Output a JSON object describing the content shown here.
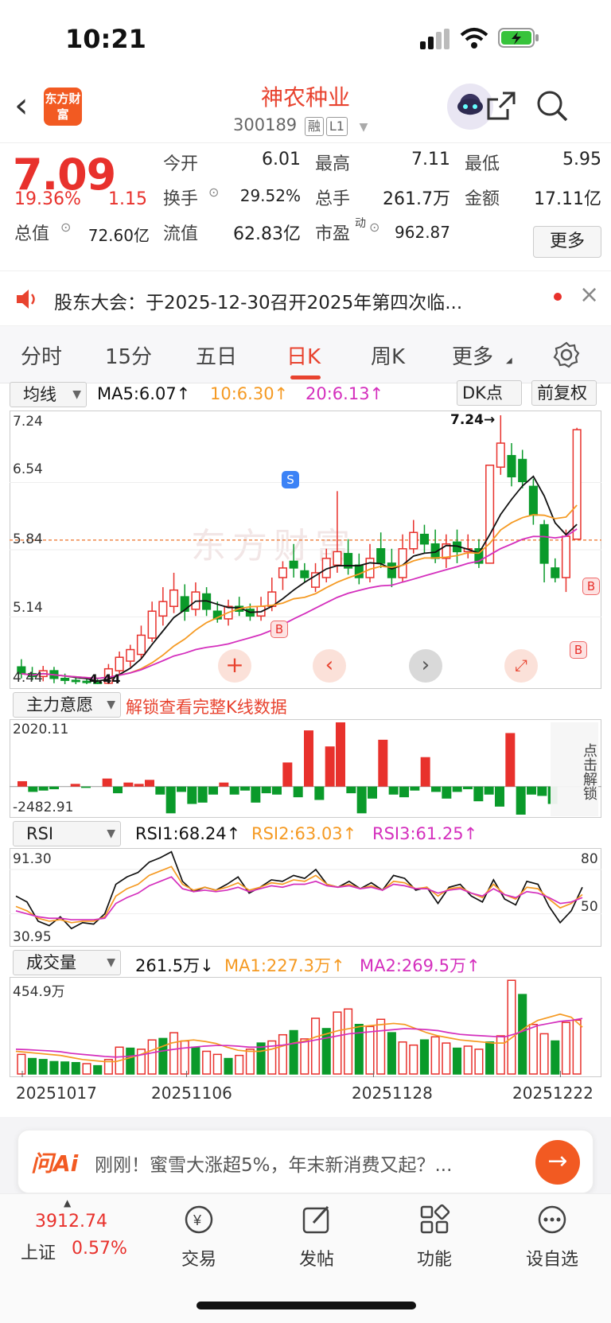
{
  "status_bar": {
    "time": "10:21"
  },
  "header": {
    "logo_text": "东方财富",
    "stock_name": "神农种业",
    "stock_code": "300189",
    "tag1": "融",
    "tag2": "L1"
  },
  "quote": {
    "price": "7.09",
    "change_pct": "19.36%",
    "change_amt": "1.15",
    "open_label": "今开",
    "open_value": "6.01",
    "high_label": "最高",
    "high_value": "7.11",
    "low_label": "最低",
    "low_value": "5.95",
    "turnover_label": "换手",
    "turnover_value": "29.52%",
    "volume_label": "总手",
    "volume_value": "261.7万",
    "amount_label": "金额",
    "amount_value": "17.11亿",
    "mktcap_label": "总值",
    "mktcap_value": "72.60亿",
    "float_label": "流值",
    "float_value": "62.83亿",
    "pe_label": "市盈",
    "pe_sup": "动",
    "pe_value": "962.87",
    "more_button": "更多"
  },
  "notice": {
    "text": "股东大会：于2025-12-30召开2025年第四次临..."
  },
  "tabs": [
    {
      "label": "分时"
    },
    {
      "label": "15分"
    },
    {
      "label": "五日"
    },
    {
      "label": "日K"
    },
    {
      "label": "周K"
    },
    {
      "label": "更多"
    }
  ],
  "kline": {
    "indicator_select": "均线",
    "ma5": "MA5:6.07↑",
    "ma10": "10:6.30↑",
    "ma20": "20:6.13↑",
    "dk_button": "DK点",
    "adjust_button": "前复权",
    "y_labels": [
      "7.24",
      "6.54",
      "5.84",
      "5.14",
      "4.44"
    ],
    "max_label": "7.24→",
    "min_label": "4.44",
    "marker_s": "S",
    "marker_b": "B",
    "watermark": "东方财富"
  },
  "main_force": {
    "select": "主力意愿",
    "unlock_text": "解锁查看完整K线数据",
    "ymax": "2020.11",
    "ymin": "-2482.91",
    "side_button": "点击解锁"
  },
  "rsi": {
    "select": "RSI",
    "rsi1": "RSI1:68.24↑",
    "rsi2": "RSI2:63.03↑",
    "rsi3": "RSI3:61.25↑",
    "ymax": "91.30",
    "ymin": "30.95",
    "r80": "80",
    "r50": "50"
  },
  "volume": {
    "select": "成交量",
    "current": "261.5万↓",
    "ma1": "MA1:227.3万↑",
    "ma2": "MA2:269.5万↑",
    "ymax": "454.9万",
    "dates": [
      "20251017",
      "20251106",
      "20251128",
      "20251222"
    ]
  },
  "ai_bar": {
    "logo": "问Ai",
    "text": "刚刚！蜜雪大涨超5%，年末新消费又起？..."
  },
  "bottom_nav": {
    "index_value": "3912.74",
    "index_name": "上证",
    "index_change": "0.57%",
    "items": [
      {
        "label": "交易"
      },
      {
        "label": "发帖"
      },
      {
        "label": "功能"
      },
      {
        "label": "设自选"
      }
    ]
  },
  "colors": {
    "up": "#e8312c",
    "down": "#0a9a2a",
    "ma5": "#111111",
    "ma10": "#f59a23",
    "ma20": "#d42fbd",
    "accent": "#e8432f"
  },
  "chart_data": {
    "type": "candlestick",
    "ylim": [
      4.44,
      7.24
    ],
    "candles": [
      {
        "o": 4.62,
        "c": 4.55,
        "h": 4.7,
        "l": 4.5
      },
      {
        "o": 4.55,
        "c": 4.52,
        "h": 4.62,
        "l": 4.48
      },
      {
        "o": 4.52,
        "c": 4.58,
        "h": 4.63,
        "l": 4.47
      },
      {
        "o": 4.58,
        "c": 4.5,
        "h": 4.62,
        "l": 4.45
      },
      {
        "o": 4.5,
        "c": 4.48,
        "h": 4.55,
        "l": 4.44
      },
      {
        "o": 4.48,
        "c": 4.47,
        "h": 4.52,
        "l": 4.44
      },
      {
        "o": 4.47,
        "c": 4.46,
        "h": 4.5,
        "l": 4.44
      },
      {
        "o": 4.46,
        "c": 4.45,
        "h": 4.5,
        "l": 4.44
      },
      {
        "o": 4.45,
        "c": 4.6,
        "h": 4.65,
        "l": 4.44
      },
      {
        "o": 4.58,
        "c": 4.72,
        "h": 4.78,
        "l": 4.55
      },
      {
        "o": 4.68,
        "c": 4.8,
        "h": 4.85,
        "l": 4.62
      },
      {
        "o": 4.75,
        "c": 4.95,
        "h": 5.05,
        "l": 4.7
      },
      {
        "o": 4.92,
        "c": 5.2,
        "h": 5.3,
        "l": 4.88
      },
      {
        "o": 5.15,
        "c": 5.3,
        "h": 5.45,
        "l": 5.05
      },
      {
        "o": 5.25,
        "c": 5.42,
        "h": 5.6,
        "l": 5.18
      },
      {
        "o": 5.35,
        "c": 5.2,
        "h": 5.48,
        "l": 5.1
      },
      {
        "o": 5.22,
        "c": 5.4,
        "h": 5.5,
        "l": 5.15
      },
      {
        "o": 5.38,
        "c": 5.22,
        "h": 5.45,
        "l": 5.15
      },
      {
        "o": 5.2,
        "c": 5.12,
        "h": 5.3,
        "l": 5.08
      },
      {
        "o": 5.12,
        "c": 5.25,
        "h": 5.32,
        "l": 5.05
      },
      {
        "o": 5.25,
        "c": 5.2,
        "h": 5.35,
        "l": 5.15
      },
      {
        "o": 5.22,
        "c": 5.15,
        "h": 5.28,
        "l": 5.1
      },
      {
        "o": 5.15,
        "c": 5.25,
        "h": 5.35,
        "l": 5.1
      },
      {
        "o": 5.25,
        "c": 5.4,
        "h": 5.55,
        "l": 5.2
      },
      {
        "o": 5.55,
        "c": 5.65,
        "h": 5.72,
        "l": 5.42
      },
      {
        "o": 5.72,
        "c": 5.65,
        "h": 5.9,
        "l": 5.55
      },
      {
        "o": 5.62,
        "c": 5.55,
        "h": 5.7,
        "l": 5.5
      },
      {
        "o": 5.45,
        "c": 5.6,
        "h": 5.7,
        "l": 5.4
      },
      {
        "o": 5.55,
        "c": 5.75,
        "h": 5.85,
        "l": 5.5
      },
      {
        "o": 5.68,
        "c": 5.82,
        "h": 6.45,
        "l": 5.6
      },
      {
        "o": 5.8,
        "c": 5.65,
        "h": 5.95,
        "l": 5.58
      },
      {
        "o": 5.68,
        "c": 5.55,
        "h": 5.8,
        "l": 5.48
      },
      {
        "o": 5.55,
        "c": 5.75,
        "h": 5.9,
        "l": 5.5
      },
      {
        "o": 5.85,
        "c": 5.7,
        "h": 6.02,
        "l": 5.65
      },
      {
        "o": 5.7,
        "c": 5.55,
        "h": 5.85,
        "l": 5.45
      },
      {
        "o": 5.55,
        "c": 5.85,
        "h": 6.0,
        "l": 5.5
      },
      {
        "o": 5.85,
        "c": 6.02,
        "h": 6.15,
        "l": 5.8
      },
      {
        "o": 6.0,
        "c": 5.9,
        "h": 6.1,
        "l": 5.8
      },
      {
        "o": 5.9,
        "c": 5.75,
        "h": 6.05,
        "l": 5.7
      },
      {
        "o": 5.75,
        "c": 5.9,
        "h": 6.0,
        "l": 5.65
      },
      {
        "o": 5.92,
        "c": 5.82,
        "h": 6.05,
        "l": 5.7
      },
      {
        "o": 5.82,
        "c": 5.85,
        "h": 6.0,
        "l": 5.75
      },
      {
        "o": 5.85,
        "c": 5.7,
        "h": 5.95,
        "l": 5.65
      },
      {
        "o": 5.7,
        "c": 6.72,
        "h": 6.72,
        "l": 5.7
      },
      {
        "o": 6.7,
        "c": 6.95,
        "h": 7.24,
        "l": 6.62
      },
      {
        "o": 6.82,
        "c": 6.6,
        "h": 6.95,
        "l": 6.5
      },
      {
        "o": 6.78,
        "c": 6.55,
        "h": 6.88,
        "l": 6.48
      },
      {
        "o": 6.5,
        "c": 6.2,
        "h": 6.58,
        "l": 6.1
      },
      {
        "o": 6.1,
        "c": 5.7,
        "h": 6.15,
        "l": 5.5
      },
      {
        "o": 5.65,
        "c": 5.55,
        "h": 5.75,
        "l": 5.5
      },
      {
        "o": 5.55,
        "c": 5.98,
        "h": 6.05,
        "l": 5.4
      },
      {
        "o": 5.95,
        "c": 7.09,
        "h": 7.11,
        "l": 5.95
      }
    ],
    "main_force": [
      40,
      -40,
      -30,
      -20,
      0,
      20,
      -10,
      0,
      60,
      -50,
      30,
      20,
      50,
      -60,
      -200,
      -40,
      -130,
      -120,
      -60,
      30,
      -60,
      -30,
      -120,
      -50,
      -60,
      180,
      -80,
      420,
      -100,
      300,
      480,
      -50,
      -200,
      -90,
      350,
      -60,
      -80,
      -30,
      220,
      -40,
      -90,
      -40,
      -20,
      -110,
      -60,
      -150,
      400,
      -210,
      -60,
      -70,
      -130
    ],
    "rsi1": [
      62,
      58,
      45,
      42,
      48,
      40,
      44,
      43,
      50,
      70,
      75,
      78,
      85,
      88,
      92,
      72,
      65,
      68,
      66,
      70,
      75,
      64,
      68,
      73,
      72,
      76,
      74,
      80,
      70,
      68,
      72,
      67,
      71,
      66,
      76,
      74,
      66,
      68,
      57,
      68,
      70,
      62,
      58,
      73,
      60,
      56,
      72,
      70,
      55,
      44,
      52,
      68
    ],
    "rsi2": [
      55,
      52,
      47,
      45,
      46,
      44,
      45,
      45,
      48,
      62,
      67,
      70,
      76,
      79,
      82,
      70,
      66,
      68,
      66,
      68,
      71,
      66,
      68,
      71,
      70,
      73,
      72,
      76,
      70,
      68,
      70,
      67,
      69,
      66,
      72,
      71,
      67,
      68,
      62,
      67,
      68,
      64,
      61,
      70,
      63,
      60,
      68,
      67,
      60,
      54,
      57,
      63
    ],
    "rsi3": [
      52,
      50,
      48,
      47,
      47,
      46,
      46,
      46,
      47,
      57,
      61,
      64,
      69,
      72,
      75,
      67,
      65,
      66,
      65,
      66,
      68,
      65,
      67,
      69,
      68,
      70,
      70,
      72,
      69,
      68,
      69,
      67,
      68,
      66,
      70,
      69,
      67,
      67,
      64,
      66,
      67,
      64,
      62,
      67,
      63,
      61,
      65,
      64,
      61,
      57,
      58,
      61
    ],
    "volume": [
      95,
      75,
      70,
      60,
      58,
      55,
      50,
      40,
      70,
      130,
      125,
      120,
      165,
      172,
      200,
      160,
      130,
      110,
      95,
      75,
      90,
      120,
      150,
      160,
      190,
      210,
      170,
      270,
      220,
      300,
      315,
      240,
      230,
      265,
      200,
      155,
      140,
      165,
      180,
      150,
      125,
      135,
      120,
      155,
      185,
      454,
      385,
      240,
      195,
      160,
      250,
      261
    ],
    "ma1": [
      110,
      105,
      100,
      95,
      90,
      80,
      70,
      65,
      60,
      60,
      75,
      90,
      110,
      130,
      150,
      160,
      165,
      158,
      148,
      130,
      115,
      110,
      110,
      120,
      135,
      150,
      160,
      180,
      195,
      210,
      220,
      230,
      235,
      240,
      245,
      240,
      220,
      200,
      185,
      175,
      165,
      160,
      155,
      150,
      150,
      190,
      230,
      260,
      275,
      290,
      275,
      227
    ],
    "ma2": [
      120,
      118,
      115,
      112,
      108,
      100,
      95,
      90,
      85,
      82,
      85,
      90,
      100,
      110,
      118,
      125,
      130,
      135,
      138,
      138,
      135,
      130,
      130,
      135,
      140,
      148,
      155,
      165,
      175,
      185,
      195,
      200,
      205,
      210,
      215,
      220,
      218,
      215,
      210,
      200,
      192,
      188,
      185,
      182,
      180,
      195,
      215,
      235,
      245,
      255,
      260,
      269
    ],
    "x_ticks": [
      "20251017",
      "20251106",
      "20251128",
      "20251222"
    ]
  }
}
